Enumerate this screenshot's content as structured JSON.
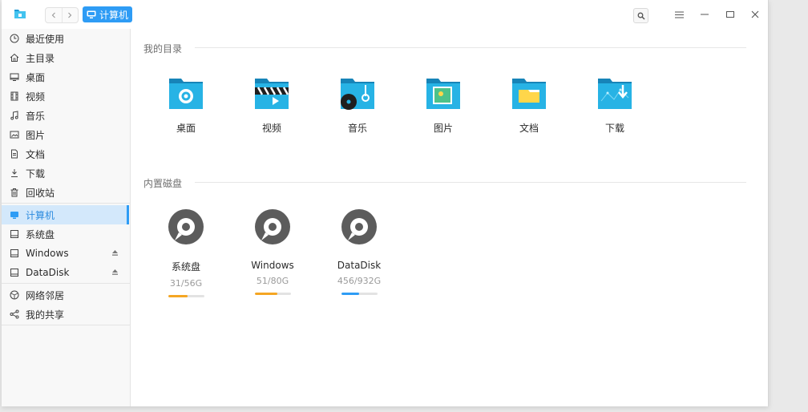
{
  "titlebar": {
    "breadcrumb_label": "计算机",
    "back_icon": "chevron-left-icon",
    "forward_icon": "chevron-right-icon",
    "search_icon": "search-icon",
    "menu_icon": "hamburger-menu-icon",
    "minimize_icon": "minimize-icon",
    "maximize_icon": "maximize-icon",
    "close_icon": "close-icon"
  },
  "sidebar": {
    "items": [
      {
        "label": "最近使用",
        "icon": "clock-icon"
      },
      {
        "label": "主目录",
        "icon": "home-icon"
      },
      {
        "label": "桌面",
        "icon": "desktop-icon"
      },
      {
        "label": "视频",
        "icon": "film-icon"
      },
      {
        "label": "音乐",
        "icon": "music-icon"
      },
      {
        "label": "图片",
        "icon": "image-icon"
      },
      {
        "label": "文档",
        "icon": "document-icon"
      },
      {
        "label": "下载",
        "icon": "download-icon"
      },
      {
        "label": "回收站",
        "icon": "trash-icon"
      },
      {
        "label": "计算机",
        "icon": "computer-icon",
        "active": true
      },
      {
        "label": "系统盘",
        "icon": "drive-icon"
      },
      {
        "label": "Windows",
        "icon": "drive-icon",
        "eject": true
      },
      {
        "label": "DataDisk",
        "icon": "drive-icon",
        "eject": true
      },
      {
        "label": "网络邻居",
        "icon": "network-icon"
      },
      {
        "label": "我的共享",
        "icon": "share-icon"
      }
    ]
  },
  "main": {
    "my_dirs_title": "我的目录",
    "folders": [
      {
        "label": "桌面",
        "icon": "desktop-folder-icon"
      },
      {
        "label": "视频",
        "icon": "video-folder-icon"
      },
      {
        "label": "音乐",
        "icon": "music-folder-icon"
      },
      {
        "label": "图片",
        "icon": "pictures-folder-icon"
      },
      {
        "label": "文档",
        "icon": "documents-folder-icon"
      },
      {
        "label": "下载",
        "icon": "downloads-folder-icon"
      }
    ],
    "disks_title": "内置磁盘",
    "disks": [
      {
        "label": "系统盘",
        "size": "31/56G",
        "used_fraction": 0.55,
        "color": "#f5a623"
      },
      {
        "label": "Windows",
        "size": "51/80G",
        "used_fraction": 0.64,
        "color": "#f5a623"
      },
      {
        "label": "DataDisk",
        "size": "456/932G",
        "used_fraction": 0.49,
        "color": "#2e9cf5"
      }
    ]
  },
  "colors": {
    "accent": "#2e9cf5",
    "folder": "#1fa8d6",
    "disk_ok": "#2e9cf5",
    "disk_warn": "#f5a623"
  }
}
